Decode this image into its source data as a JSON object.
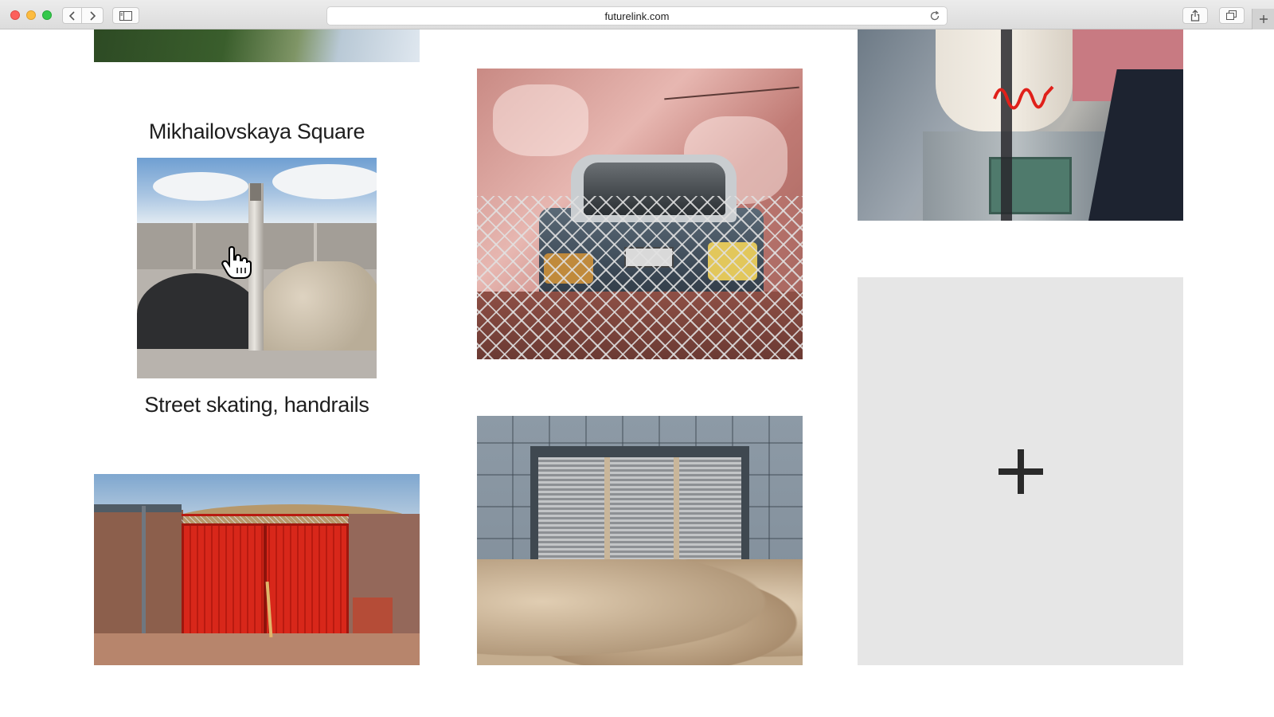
{
  "browser": {
    "url": "futurelink.com",
    "icons": {
      "back": "chevron-left-icon",
      "forward": "chevron-right-icon",
      "sidebar": "sidebar-icon",
      "reload": "reload-icon",
      "share": "share-icon",
      "tabs": "tabs-overview-icon",
      "new_tab": "plus-icon"
    }
  },
  "gallery": {
    "captions": {
      "mikhailovskaya": "Mikhailovskaya Square",
      "street_skating": "Street skating, handrails"
    },
    "photos": [
      {
        "subject": "landscape-with-grass"
      },
      {
        "subject": "gravel-piles-by-concrete-wall"
      },
      {
        "subject": "car-behind-chain-link-fence"
      },
      {
        "subject": "statue-bust-on-pedestal"
      },
      {
        "subject": "red-gate"
      },
      {
        "subject": "shuttered-window-with-rocks"
      }
    ],
    "add_card": {
      "icon": "plus-icon"
    }
  },
  "cursor": {
    "type": "hand-pointer"
  }
}
